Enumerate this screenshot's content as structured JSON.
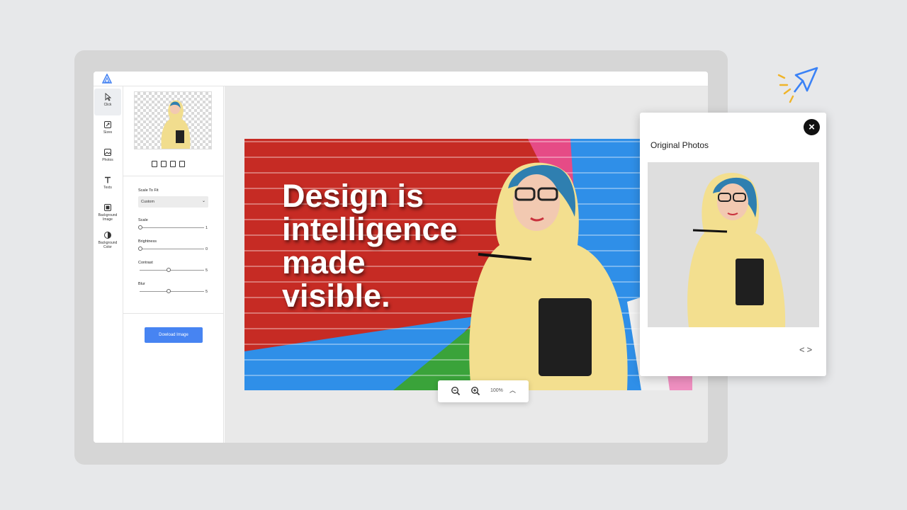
{
  "toolbar": {
    "items": [
      {
        "label": "Click",
        "icon": "cursor-icon"
      },
      {
        "label": "Sizes",
        "icon": "resize-icon"
      },
      {
        "label": "Photos",
        "icon": "photo-icon"
      },
      {
        "label": "Texts",
        "icon": "text-icon"
      },
      {
        "label": "Background Image",
        "icon": "background-image-icon"
      },
      {
        "label": "Background Color",
        "icon": "contrast-icon"
      }
    ]
  },
  "panel": {
    "scale_to_fit_label": "Scale To Fit",
    "scale_to_fit_value": "Custom",
    "sliders": [
      {
        "label": "Scale",
        "value": "1",
        "position": 0
      },
      {
        "label": "Brightness",
        "value": "0",
        "position": 0
      },
      {
        "label": "Contrast",
        "value": "5",
        "position": 0.45
      },
      {
        "label": "Blur",
        "value": "5",
        "position": 0.45
      }
    ],
    "download_label": "Dowload Image"
  },
  "canvas": {
    "headline_lines": [
      "Design is",
      "intelligence",
      "made",
      "visible."
    ]
  },
  "zoom": {
    "value": "100%"
  },
  "popup": {
    "title": "Original Photos",
    "close_symbol": "×",
    "nav": "<>"
  },
  "colors": {
    "accent": "#4784f2",
    "brick_red": "#c62b24",
    "hoodie_yellow": "#f3df8f"
  }
}
